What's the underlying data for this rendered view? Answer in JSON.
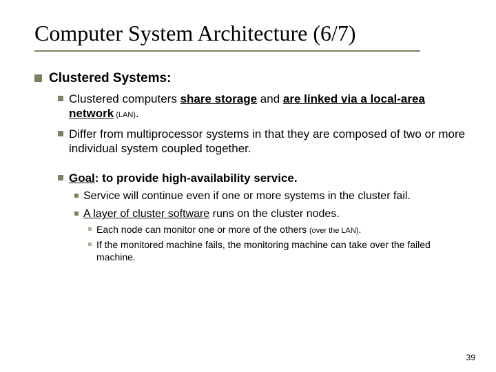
{
  "title": "Computer System Architecture (6/7)",
  "heading": "Clustered Systems:",
  "b1": {
    "pre": "Clustered computers ",
    "u1": "share storage",
    "mid": " and ",
    "u2": "are linked via a local-area network",
    "post_small": " (LAN)",
    "post": "."
  },
  "b2": "Differ from multiprocessor systems in that they are composed of two or more individual system coupled together.",
  "b3": {
    "label": "Goal",
    "text": ": to provide high-availability service."
  },
  "s1": "Service will continue even if one or more systems in the cluster fail.",
  "s2": {
    "u": "A layer of cluster software",
    "rest": " runs on the cluster nodes."
  },
  "t1": {
    "pre": "Each node can monitor one or more of the others ",
    "small": "(over the LAN)",
    "post": "."
  },
  "t2": "If the monitored machine fails, the monitoring machine can take over the failed machine.",
  "page": "39"
}
